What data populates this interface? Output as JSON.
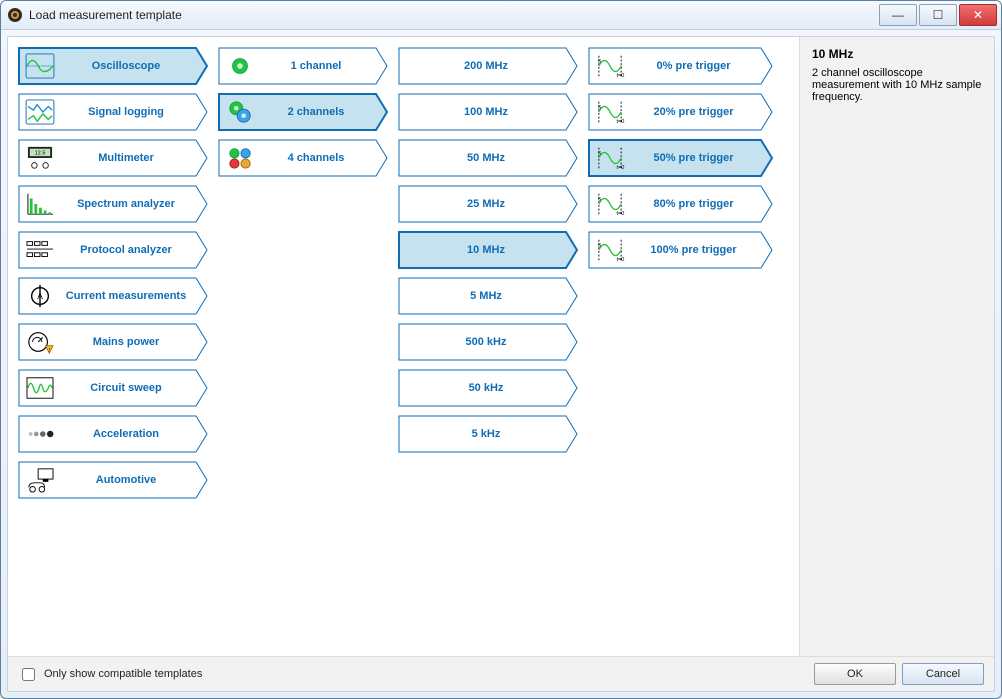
{
  "window": {
    "title": "Load measurement template"
  },
  "col1": [
    {
      "key": "oscilloscope",
      "label": "Oscilloscope",
      "icon": "oscilloscope-icon",
      "selected": true
    },
    {
      "key": "signal-logging",
      "label": "Signal logging",
      "icon": "signal-logging-icon",
      "selected": false
    },
    {
      "key": "multimeter",
      "label": "Multimeter",
      "icon": "multimeter-icon",
      "selected": false
    },
    {
      "key": "spectrum-analyzer",
      "label": "Spectrum analyzer",
      "icon": "spectrum-analyzer-icon",
      "selected": false
    },
    {
      "key": "protocol-analyzer",
      "label": "Protocol analyzer",
      "icon": "protocol-analyzer-icon",
      "selected": false
    },
    {
      "key": "current-measurements",
      "label": "Current measurements",
      "icon": "current-measurements-icon",
      "selected": false
    },
    {
      "key": "mains-power",
      "label": "Mains power",
      "icon": "mains-power-icon",
      "selected": false
    },
    {
      "key": "circuit-sweep",
      "label": "Circuit sweep",
      "icon": "circuit-sweep-icon",
      "selected": false
    },
    {
      "key": "acceleration",
      "label": "Acceleration",
      "icon": "acceleration-icon",
      "selected": false
    },
    {
      "key": "automotive",
      "label": "Automotive",
      "icon": "automotive-icon",
      "selected": false
    }
  ],
  "col2": [
    {
      "key": "1ch",
      "label": "1 channel",
      "icon": "channel1-icon",
      "selected": false
    },
    {
      "key": "2ch",
      "label": "2 channels",
      "icon": "channel2-icon",
      "selected": true
    },
    {
      "key": "4ch",
      "label": "4 channels",
      "icon": "channel4-icon",
      "selected": false
    }
  ],
  "col3": [
    {
      "key": "200mhz",
      "label": "200 MHz",
      "selected": false
    },
    {
      "key": "100mhz",
      "label": "100 MHz",
      "selected": false
    },
    {
      "key": "50mhz",
      "label": "50 MHz",
      "selected": false
    },
    {
      "key": "25mhz",
      "label": "25 MHz",
      "selected": false
    },
    {
      "key": "10mhz",
      "label": "10 MHz",
      "selected": true
    },
    {
      "key": "5mhz",
      "label": "5 MHz",
      "selected": false
    },
    {
      "key": "500khz",
      "label": "500 kHz",
      "selected": false
    },
    {
      "key": "50khz",
      "label": "50 kHz",
      "selected": false
    },
    {
      "key": "5khz",
      "label": "5 kHz",
      "selected": false
    }
  ],
  "col4": [
    {
      "key": "pt0",
      "label": "0% pre trigger",
      "icon": "pretrigger-icon",
      "selected": false
    },
    {
      "key": "pt20",
      "label": "20% pre trigger",
      "icon": "pretrigger-icon",
      "selected": false
    },
    {
      "key": "pt50",
      "label": "50% pre trigger",
      "icon": "pretrigger-icon",
      "selected": true
    },
    {
      "key": "pt80",
      "label": "80% pre trigger",
      "icon": "pretrigger-icon",
      "selected": false
    },
    {
      "key": "pt100",
      "label": "100% pre trigger",
      "icon": "pretrigger-icon",
      "selected": false
    }
  ],
  "info": {
    "title": "10 MHz",
    "description": "2 channel oscilloscope measurement with 10 MHz sample frequency."
  },
  "footer": {
    "checkbox_label": "Only show compatible templates",
    "checkbox_checked": false,
    "ok": "OK",
    "cancel": "Cancel"
  },
  "icons": {
    "minimize": "—",
    "maximize": "☐",
    "close": "✕"
  }
}
